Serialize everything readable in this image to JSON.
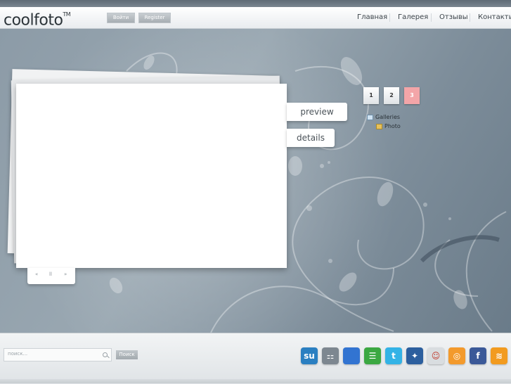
{
  "header": {
    "logo": "coolfoto",
    "logo_tm": "TM",
    "login_label": "Войти",
    "register_label": "Register",
    "nav": [
      {
        "label": "Главная",
        "active": true
      },
      {
        "label": "Галерея",
        "active": false
      },
      {
        "label": "Отзывы",
        "active": false
      },
      {
        "label": "Контакты",
        "active": false
      }
    ]
  },
  "gallery": {
    "tabs": {
      "preview": "preview",
      "details": "details"
    },
    "controls": {
      "prev": "«",
      "pause": "ll",
      "next": "»"
    },
    "pages": [
      {
        "label": "1",
        "active": false
      },
      {
        "label": "2",
        "active": false
      },
      {
        "label": "3",
        "active": true
      }
    ],
    "tree": {
      "root": "Galleries",
      "child": "Photo"
    }
  },
  "footer": {
    "search_placeholder": "поиск...",
    "search_button": "Поиск",
    "social": [
      {
        "name": "stumbleupon-icon",
        "glyph": "su",
        "color": "#2a7fc1"
      },
      {
        "name": "digg-icon",
        "glyph": "⚏",
        "color": "#7d8790"
      },
      {
        "name": "delicious-icon",
        "glyph": "",
        "color": "#3274d1"
      },
      {
        "name": "technorati-icon",
        "glyph": "☰",
        "color": "#3ba842"
      },
      {
        "name": "twitter-icon",
        "glyph": "t",
        "color": "#33b3e6"
      },
      {
        "name": "myspace-icon",
        "glyph": "✦",
        "color": "#2c5f9e"
      },
      {
        "name": "reddit-icon",
        "glyph": "☺",
        "color": "#d9dde0"
      },
      {
        "name": "lifesaver-icon",
        "glyph": "◎",
        "color": "#f39a2c"
      },
      {
        "name": "facebook-icon",
        "glyph": "f",
        "color": "#3b5998"
      },
      {
        "name": "rss-icon",
        "glyph": "≋",
        "color": "#f29b1f"
      }
    ]
  },
  "colors": {
    "active_page": "#f3a5a8",
    "background": "#8c9ba7"
  }
}
